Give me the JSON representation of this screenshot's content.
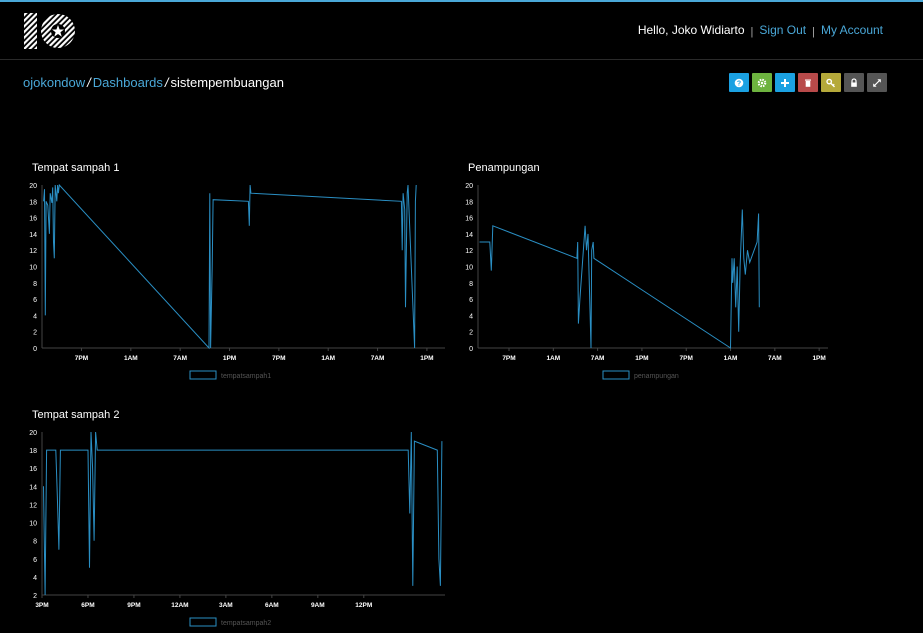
{
  "header": {
    "greeting": "Hello, Joko Widiarto",
    "sign_out": "Sign Out",
    "my_account": "My Account",
    "separator": "|"
  },
  "breadcrumb": {
    "user": "ojokondow",
    "dashboards": "Dashboards",
    "current": "sistempembuangan",
    "slash": "/"
  },
  "toolbar": [
    {
      "name": "help-button",
      "icon": "question-icon",
      "color": "#1ba1e2"
    },
    {
      "name": "settings-button",
      "icon": "gear-icon",
      "color": "#6db33f"
    },
    {
      "name": "add-block-button",
      "icon": "plus-icon",
      "color": "#1ba1e2"
    },
    {
      "name": "delete-button",
      "icon": "trash-icon",
      "color": "#b84a4a"
    },
    {
      "name": "key-button",
      "icon": "key-icon",
      "color": "#b5a93a"
    },
    {
      "name": "lock-button",
      "icon": "lock-icon",
      "color": "#555555"
    },
    {
      "name": "fullscreen-button",
      "icon": "expand-icon",
      "color": "#555555"
    }
  ],
  "colors": {
    "accent": "#4aa8d8",
    "line": "#2a8fc4"
  },
  "chart_data": [
    {
      "type": "line",
      "title": "Tempat sampah 1",
      "series": [
        {
          "name": "tempatsampah1"
        }
      ],
      "ylim": [
        0,
        20
      ],
      "yticks": [
        0,
        2,
        4,
        6,
        8,
        10,
        12,
        14,
        16,
        18,
        20
      ],
      "xticks": [
        "7PM",
        "1AM",
        "7AM",
        "1PM",
        "7PM",
        "1AM",
        "7AM",
        "1PM"
      ],
      "x_start_hours": -4.8,
      "x_per_tick_hours": 6,
      "x_end_hours": 44.2,
      "points": [
        [
          -4.6,
          18
        ],
        [
          -4.5,
          19.5
        ],
        [
          -4.4,
          4
        ],
        [
          -4.3,
          18
        ],
        [
          -4.1,
          17.5
        ],
        [
          -3.9,
          14
        ],
        [
          -3.8,
          19
        ],
        [
          -3.6,
          17.8
        ],
        [
          -3.5,
          19.7
        ],
        [
          -3.4,
          13
        ],
        [
          -3.3,
          11
        ],
        [
          -3.2,
          20
        ],
        [
          -3.0,
          18
        ],
        [
          -2.9,
          20
        ],
        [
          -2.8,
          19
        ],
        [
          -2.7,
          20
        ],
        [
          15.5,
          0
        ],
        [
          15.6,
          19
        ],
        [
          15.7,
          0
        ],
        [
          15.9,
          10
        ],
        [
          16.0,
          18.2
        ],
        [
          20.3,
          18
        ],
        [
          20.4,
          15
        ],
        [
          20.5,
          20
        ],
        [
          20.6,
          19
        ],
        [
          38.9,
          18
        ],
        [
          39.0,
          12
        ],
        [
          39.1,
          19
        ],
        [
          39.3,
          17
        ],
        [
          39.4,
          5
        ],
        [
          39.6,
          19
        ],
        [
          39.7,
          20
        ],
        [
          40.5,
          0
        ],
        [
          40.6,
          18
        ],
        [
          40.7,
          20
        ]
      ]
    },
    {
      "type": "line",
      "title": "Penampungan",
      "series": [
        {
          "name": "penampungan"
        }
      ],
      "ylim": [
        0,
        20
      ],
      "yticks": [
        0,
        2,
        4,
        6,
        8,
        10,
        12,
        14,
        16,
        18,
        20
      ],
      "xticks": [
        "7PM",
        "1AM",
        "7AM",
        "1PM",
        "7PM",
        "1AM",
        "7AM",
        "1PM"
      ],
      "x_start_hours": -4.2,
      "x_per_tick_hours": 6,
      "x_end_hours": 43.2,
      "points": [
        [
          -4.0,
          13
        ],
        [
          -2.6,
          13
        ],
        [
          -2.4,
          9.5
        ],
        [
          -2.3,
          12
        ],
        [
          -2.2,
          15
        ],
        [
          9.2,
          11
        ],
        [
          9.3,
          13
        ],
        [
          9.4,
          3
        ],
        [
          9.6,
          6
        ],
        [
          10.3,
          15
        ],
        [
          10.5,
          12
        ],
        [
          10.7,
          14
        ],
        [
          11.1,
          0
        ],
        [
          11.2,
          12
        ],
        [
          11.4,
          13
        ],
        [
          11.5,
          11
        ],
        [
          30.0,
          0
        ],
        [
          30.2,
          11
        ],
        [
          30.3,
          8
        ],
        [
          30.5,
          11
        ],
        [
          30.7,
          5
        ],
        [
          30.9,
          10
        ],
        [
          31.1,
          2
        ],
        [
          31.3,
          10
        ],
        [
          31.6,
          17
        ],
        [
          31.8,
          11
        ],
        [
          32.0,
          9
        ],
        [
          32.3,
          12
        ],
        [
          32.6,
          10.5
        ],
        [
          33.6,
          13
        ],
        [
          33.8,
          16.5
        ],
        [
          33.9,
          5
        ]
      ]
    },
    {
      "type": "line",
      "title": "Tempat sampah 2",
      "series": [
        {
          "name": "tempatsampah2"
        }
      ],
      "ylim": [
        2,
        20
      ],
      "yticks": [
        2,
        4,
        6,
        8,
        10,
        12,
        14,
        16,
        18,
        20
      ],
      "xticks": [
        "3PM",
        "6PM",
        "9PM",
        "12AM",
        "3AM",
        "6AM",
        "9AM",
        "12PM"
      ],
      "x_start_hours": -3.0,
      "x_per_tick_hours": 3,
      "x_end_hours": 23.3,
      "points": [
        [
          -2.9,
          14
        ],
        [
          -2.8,
          2
        ],
        [
          -2.7,
          18
        ],
        [
          -2.1,
          18
        ],
        [
          -2.0,
          13
        ],
        [
          -1.9,
          7
        ],
        [
          -1.8,
          18
        ],
        [
          0.0,
          18
        ],
        [
          0.1,
          5
        ],
        [
          0.2,
          20
        ],
        [
          0.3,
          16
        ],
        [
          0.4,
          8
        ],
        [
          0.5,
          20
        ],
        [
          0.6,
          18
        ],
        [
          20.9,
          18
        ],
        [
          21.0,
          11
        ],
        [
          21.1,
          20
        ],
        [
          21.2,
          3
        ],
        [
          21.3,
          19
        ],
        [
          22.8,
          18
        ],
        [
          22.9,
          6
        ],
        [
          23.0,
          3
        ],
        [
          23.1,
          19
        ]
      ]
    }
  ]
}
